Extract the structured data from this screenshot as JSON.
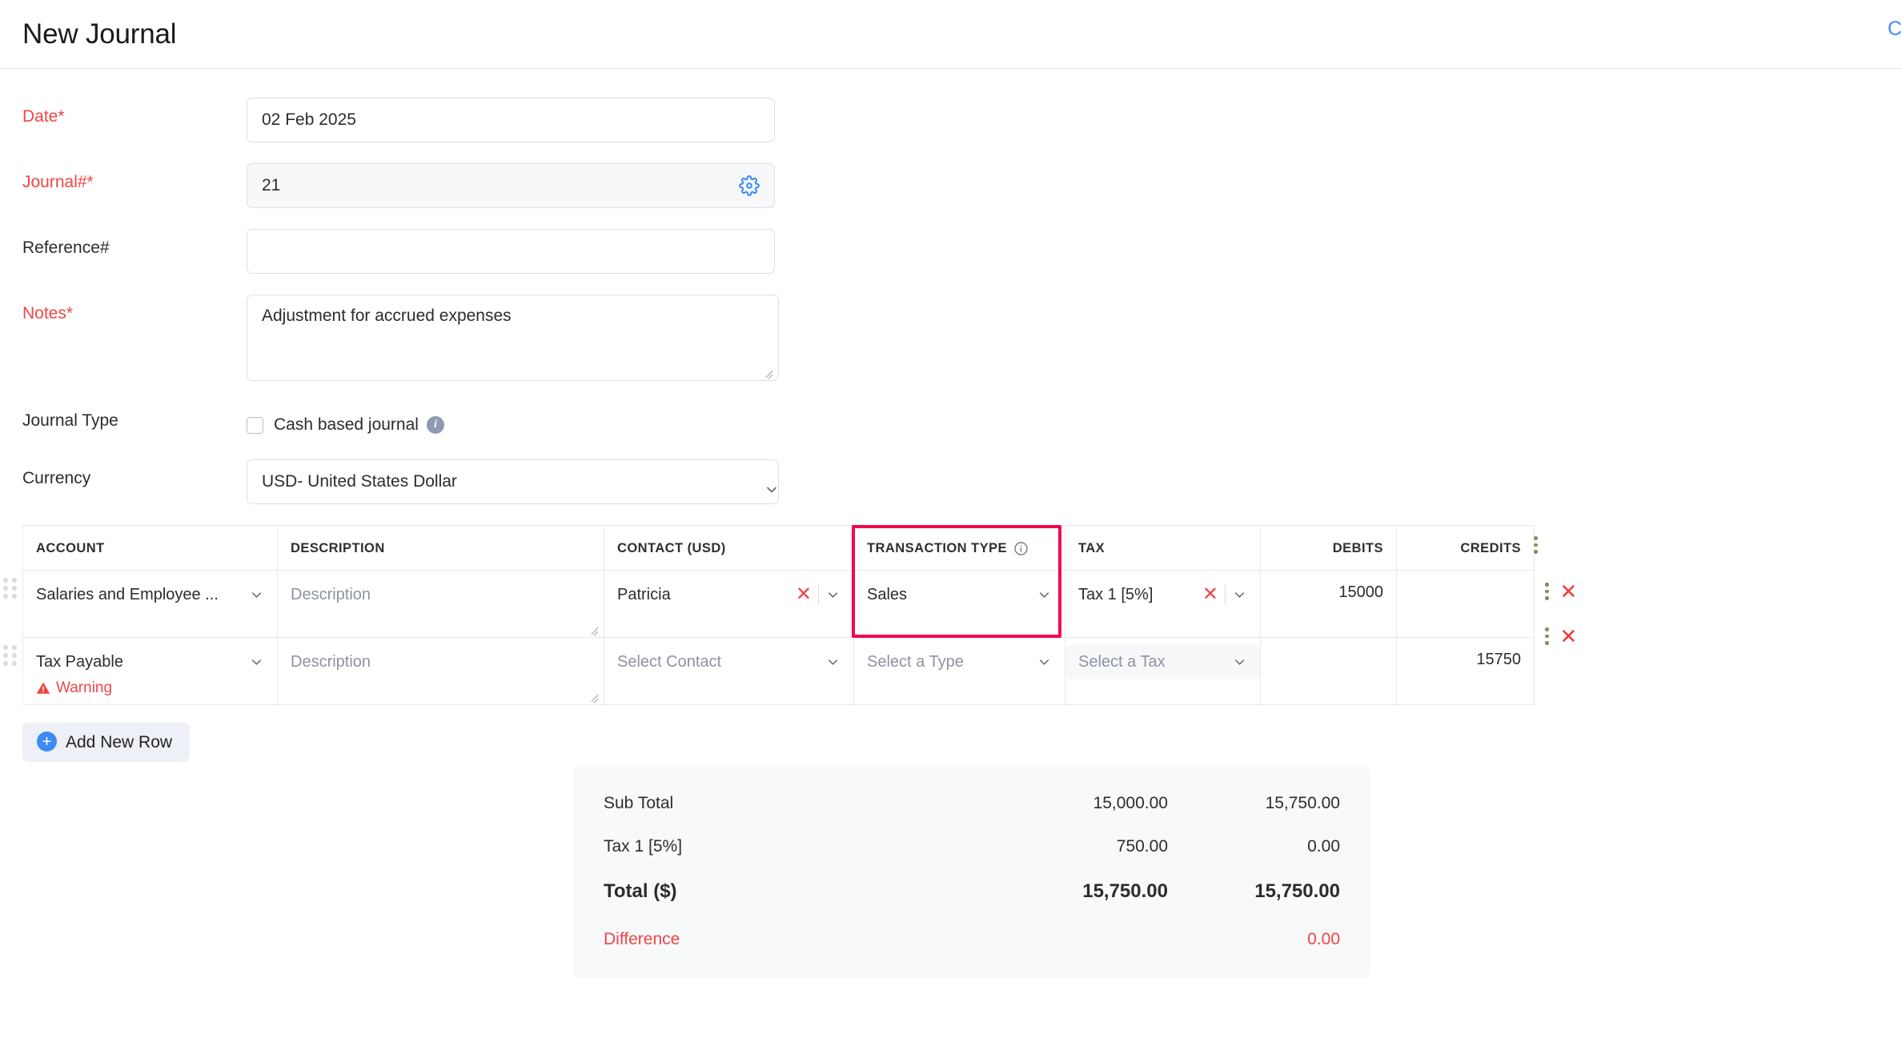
{
  "header": {
    "title": "New Journal",
    "right_link": "Ch"
  },
  "colors": {
    "required": "#f04545",
    "accent_blue": "#408dfb",
    "highlight_box": "#f5054f",
    "panel_bg": "#f8f9fb"
  },
  "form": {
    "date": {
      "label": "Date*",
      "value": "02 Feb 2025"
    },
    "journal_no": {
      "label": "Journal#*",
      "value": "21",
      "icon": "gear-icon"
    },
    "reference_no": {
      "label": "Reference#",
      "value": "",
      "placeholder": ""
    },
    "notes": {
      "label": "Notes*",
      "value": "Adjustment for accrued expenses"
    },
    "journal_type": {
      "label": "Journal Type",
      "checkbox_label": "Cash based journal",
      "checked": false,
      "info_icon": "info-icon"
    },
    "currency": {
      "label": "Currency",
      "value": "USD- United States Dollar"
    }
  },
  "items_table": {
    "columns": [
      {
        "key": "account",
        "label": "ACCOUNT",
        "align": "left"
      },
      {
        "key": "description",
        "label": "DESCRIPTION",
        "align": "left"
      },
      {
        "key": "contact",
        "label": "CONTACT (USD)",
        "align": "left"
      },
      {
        "key": "transaction_type",
        "label": "TRANSACTION TYPE",
        "align": "left",
        "info_icon": "info-icon"
      },
      {
        "key": "tax",
        "label": "TAX",
        "align": "left"
      },
      {
        "key": "debits",
        "label": "DEBITS",
        "align": "right"
      },
      {
        "key": "credits",
        "label": "CREDITS",
        "align": "right"
      }
    ],
    "header_kebab": "kebab-icon",
    "highlighted_column": "TRANSACTION TYPE",
    "rows": [
      {
        "account": "Salaries and Employee ...",
        "description_placeholder": "Description",
        "description": "",
        "contact": "Patricia",
        "contact_clearable": true,
        "transaction_type": "Sales",
        "tax": "Tax 1 [5%]",
        "tax_clearable": true,
        "tax_disabled": false,
        "debits": "15000",
        "credits": "",
        "warning": ""
      },
      {
        "account": "Tax Payable",
        "description_placeholder": "Description",
        "description": "",
        "contact": "",
        "contact_placeholder": "Select Contact",
        "contact_clearable": false,
        "transaction_type": "",
        "transaction_type_placeholder": "Select a Type",
        "tax": "",
        "tax_placeholder": "Select a Tax",
        "tax_clearable": false,
        "tax_disabled": true,
        "debits": "",
        "credits": "15750",
        "warning": "Warning"
      }
    ]
  },
  "add_row_button": {
    "label": "Add New Row",
    "icon": "plus-circle-icon"
  },
  "totals": {
    "rows": [
      {
        "label": "Sub Total",
        "debit": "15,000.00",
        "credit": "15,750.00",
        "style": "normal"
      },
      {
        "label": "Tax 1 [5%]",
        "debit": "750.00",
        "credit": "0.00",
        "style": "normal"
      },
      {
        "label": "Total ($)",
        "debit": "15,750.00",
        "credit": "15,750.00",
        "style": "grand"
      },
      {
        "label": "Difference",
        "debit": "",
        "credit": "0.00",
        "style": "diff"
      }
    ]
  }
}
